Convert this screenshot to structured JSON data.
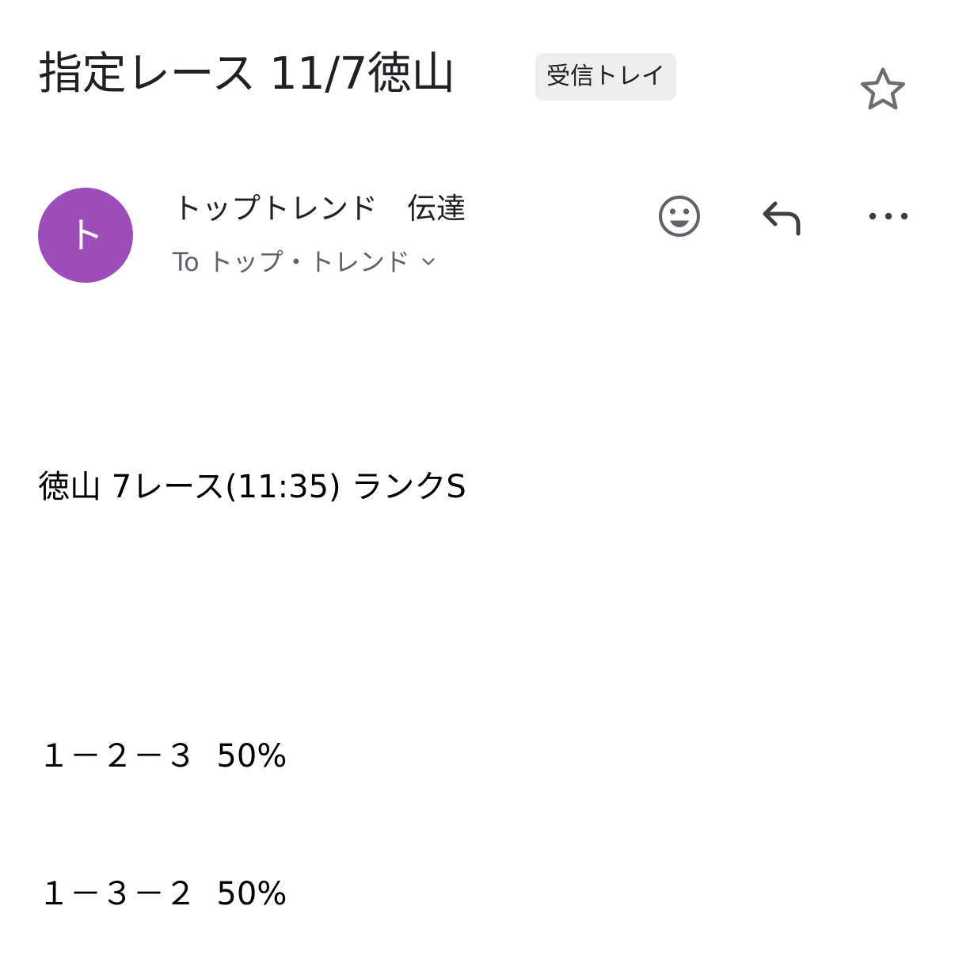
{
  "email": {
    "subject": "指定レース 11/7徳山",
    "label": "受信トレイ",
    "sender": {
      "initial": "ト",
      "name": "トップトレンド　伝達",
      "to_line": "To トップ・トレンド"
    },
    "body": {
      "line1": "徳山 7レース(11:35) ランクS",
      "line2": "１－２－３  50%",
      "line3": "１－３－２  50%"
    }
  },
  "icons": {
    "star": "star-icon",
    "emoji": "emoji-icon",
    "reply": "reply-icon",
    "more": "more-vertical-icon",
    "chevron": "chevron-down-icon"
  },
  "colors": {
    "avatar": "#9c4dba",
    "chip_bg": "#eeeeee",
    "secondary_text": "#5f6368",
    "icon": "#5f6368"
  }
}
